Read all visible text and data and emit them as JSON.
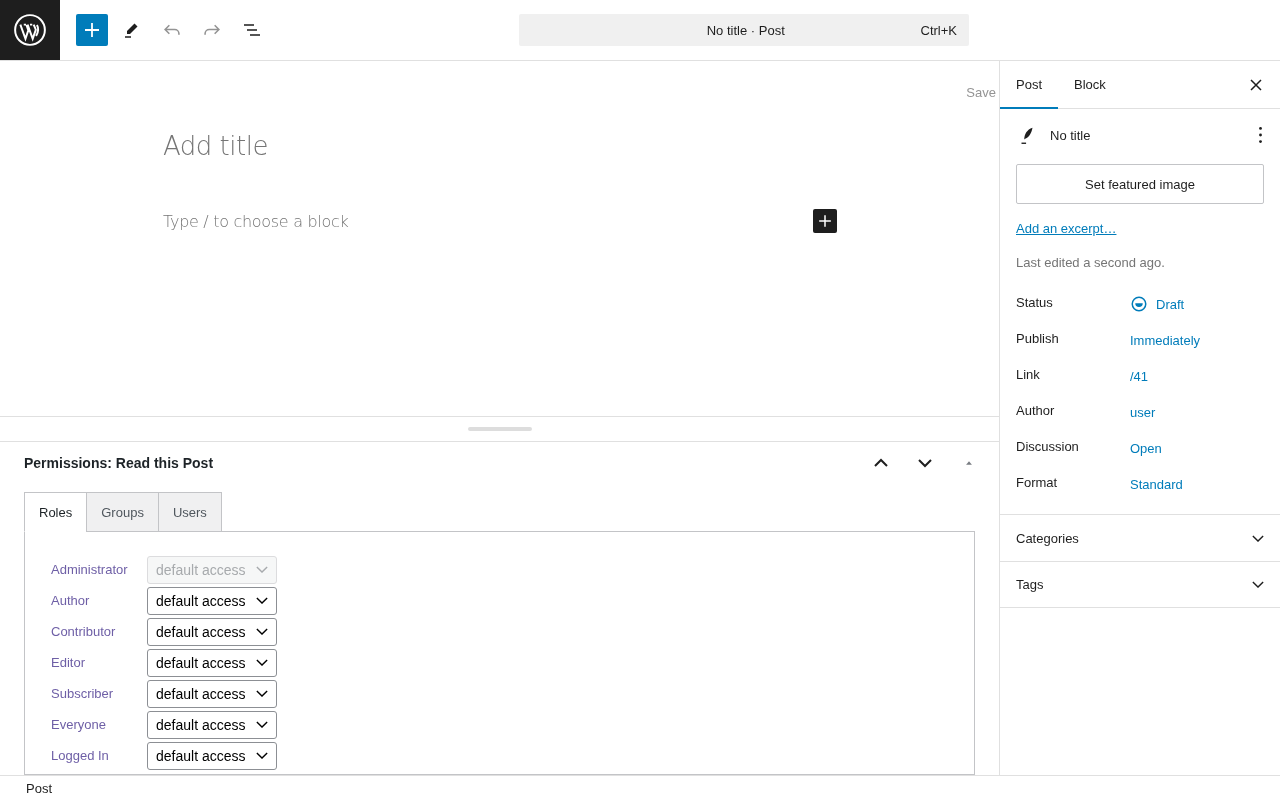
{
  "toolbar": {
    "command_bar": {
      "title": "No title · Post",
      "shortcut": "Ctrl+K"
    }
  },
  "editor": {
    "save": "Save",
    "title_placeholder": "Add title",
    "block_placeholder": "Type / to choose a block"
  },
  "meta_box": {
    "title": "Permissions: Read this Post",
    "tabs": [
      {
        "label": "Roles",
        "selected": true
      },
      {
        "label": "Groups",
        "selected": false
      },
      {
        "label": "Users",
        "selected": false
      }
    ],
    "rows": [
      {
        "role": "Administrator",
        "value": "default access",
        "disabled": true
      },
      {
        "role": "Author",
        "value": "default access",
        "disabled": false
      },
      {
        "role": "Contributor",
        "value": "default access",
        "disabled": false
      },
      {
        "role": "Editor",
        "value": "default access",
        "disabled": false
      },
      {
        "role": "Subscriber",
        "value": "default access",
        "disabled": false
      },
      {
        "role": "Everyone",
        "value": "default access",
        "disabled": false
      },
      {
        "role": "Logged In",
        "value": "default access",
        "disabled": false
      }
    ]
  },
  "sidebar": {
    "tabs": [
      {
        "label": "Post",
        "selected": true
      },
      {
        "label": "Block",
        "selected": false
      }
    ],
    "post_title": "No title",
    "featured_image_button": "Set featured image",
    "excerpt_link": "Add an excerpt…",
    "last_edited": "Last edited a second ago.",
    "fields": [
      {
        "label": "Status",
        "value": "Draft",
        "kind": "status"
      },
      {
        "label": "Publish",
        "value": "Immediately",
        "kind": "link"
      },
      {
        "label": "Link",
        "value": "/41",
        "kind": "link"
      },
      {
        "label": "Author",
        "value": "user",
        "kind": "link"
      },
      {
        "label": "Discussion",
        "value": "Open",
        "kind": "link"
      },
      {
        "label": "Format",
        "value": "Standard",
        "kind": "link"
      }
    ],
    "sections": [
      {
        "label": "Categories",
        "expanded": false
      },
      {
        "label": "Tags",
        "expanded": false
      }
    ]
  },
  "status_bar": {
    "breadcrumb": "Post"
  }
}
